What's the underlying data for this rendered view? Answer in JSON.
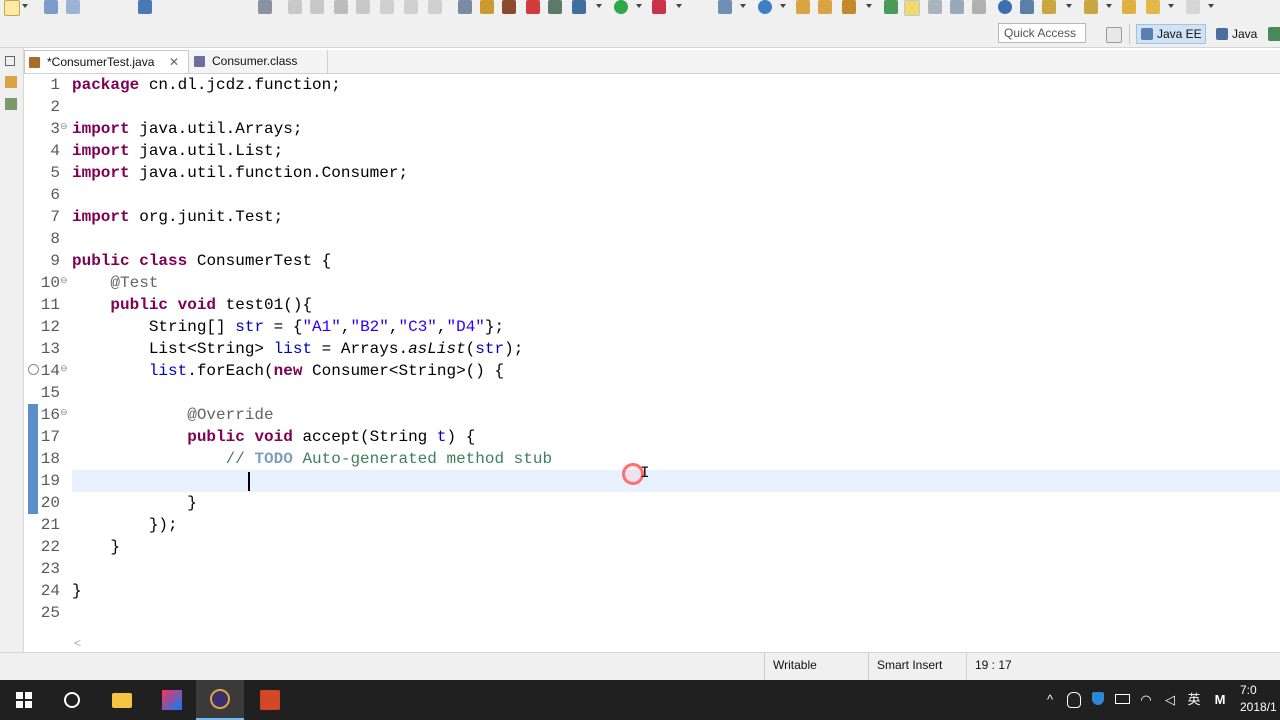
{
  "toolbar": {
    "quick_access_placeholder": "Quick Access",
    "perspectives": [
      {
        "label": "Java EE",
        "active": true
      },
      {
        "label": "Java",
        "active": false
      }
    ]
  },
  "tabs": [
    {
      "label": "*ConsumerTest.java",
      "active": true,
      "dirty": true,
      "close": "✕"
    },
    {
      "label": "Consumer.class",
      "active": false
    }
  ],
  "editor": {
    "line_numbers": [
      "1",
      "2",
      "3",
      "4",
      "5",
      "6",
      "7",
      "8",
      "9",
      "10",
      "11",
      "12",
      "13",
      "14",
      "15",
      "16",
      "17",
      "18",
      "19",
      "20",
      "21",
      "22",
      "23",
      "24",
      "25"
    ],
    "current_line": 19
  },
  "status": {
    "writable": "Writable",
    "insert_mode": "Smart Insert",
    "position": "19 : 17"
  },
  "taskbar": {
    "ime": "英",
    "clock_time": "7:0",
    "clock_date": "2018/1"
  },
  "colors": {
    "keyword": "#7f0055",
    "string": "#2a00ff",
    "comment": "#3f7f5f",
    "annotation": "#646464",
    "current_line": "#e8f2fe",
    "taskbar": "#202020"
  }
}
